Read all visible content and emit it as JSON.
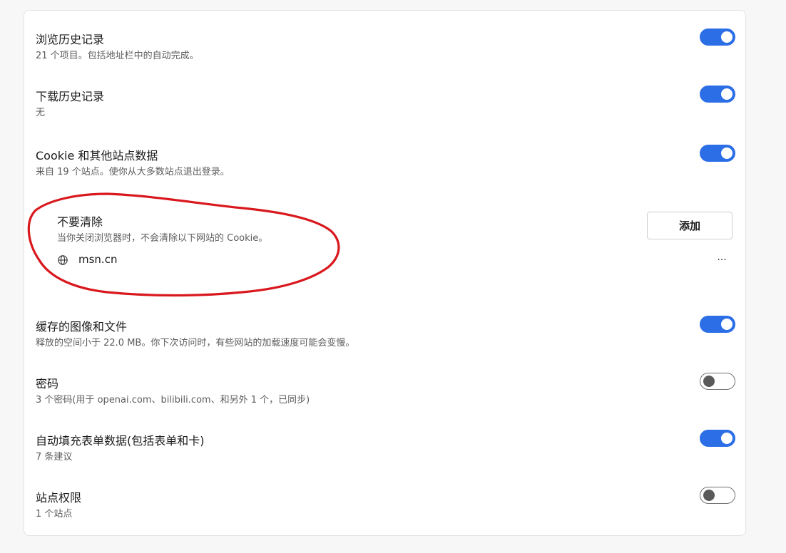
{
  "items": [
    {
      "title": "浏览历史记录",
      "desc": "21 个项目。包括地址栏中的自动完成。",
      "enabled": true
    },
    {
      "title": "下载历史记录",
      "desc": "无",
      "enabled": true
    },
    {
      "title": "Cookie 和其他站点数据",
      "desc": "来自 19 个站点。使你从大多数站点退出登录。",
      "enabled": true
    },
    {
      "title": "缓存的图像和文件",
      "desc": "释放的空间小于 22.0 MB。你下次访问时，有些网站的加载速度可能会变慢。",
      "enabled": true
    },
    {
      "title": "密码",
      "desc": "3 个密码(用于 openai.com、bilibili.com、和另外 1 个，已同步)",
      "enabled": false
    },
    {
      "title": "自动填充表单数据(包括表单和卡)",
      "desc": "7 条建议",
      "enabled": true
    },
    {
      "title": "站点权限",
      "desc": "1 个站点",
      "enabled": false
    }
  ],
  "dont_clear": {
    "title": "不要清除",
    "desc": "当你关闭浏览器时，不会清除以下网站的 Cookie。",
    "add_label": "添加",
    "site": "msn.cn",
    "more_label": "..."
  },
  "colors": {
    "accent": "#2b6ee6",
    "annotation": "#d9181e"
  }
}
